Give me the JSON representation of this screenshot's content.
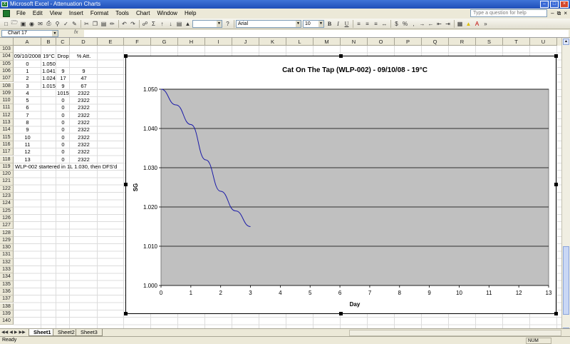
{
  "window": {
    "title": "Microsoft Excel - Attenuation Charts",
    "app_icon": "X"
  },
  "menu": {
    "items": [
      "File",
      "Edit",
      "View",
      "Insert",
      "Format",
      "Tools",
      "Chart",
      "Window",
      "Help"
    ],
    "help_placeholder": "Type a question for help"
  },
  "toolbar": {
    "font_name": "Arial",
    "font_size": "10",
    "bold_label": "B",
    "italic_label": "I",
    "underline_label": "U"
  },
  "formula": {
    "name_box": "Chart 17",
    "fx_label": "fx"
  },
  "columns": [
    "A",
    "B",
    "C",
    "D",
    "E",
    "F",
    "G",
    "H",
    "I",
    "J",
    "K",
    "L",
    "M",
    "N",
    "O",
    "P",
    "Q",
    "R",
    "S",
    "T",
    "U"
  ],
  "rows": [
    "103",
    "104",
    "105",
    "106",
    "107",
    "108",
    "109",
    "110",
    "111",
    "112",
    "113",
    "114",
    "115",
    "116",
    "117",
    "118",
    "119",
    "120",
    "121",
    "122",
    "123",
    "124",
    "125",
    "126",
    "127",
    "128",
    "129",
    "130",
    "131",
    "132",
    "133",
    "134",
    "135",
    "136",
    "137",
    "138",
    "139",
    "140"
  ],
  "cells": {
    "r104": [
      "09/10/2008",
      "19°C",
      "Drop",
      "% Att."
    ],
    "data": [
      [
        "0",
        "1.050",
        "",
        ""
      ],
      [
        "1",
        "1.041",
        "9",
        "9"
      ],
      [
        "2",
        "1.024",
        "17",
        "47"
      ],
      [
        "3",
        "1.015",
        "9",
        "67"
      ],
      [
        "4",
        "",
        "1015",
        "2322"
      ],
      [
        "5",
        "",
        "0",
        "2322"
      ],
      [
        "6",
        "",
        "0",
        "2322"
      ],
      [
        "7",
        "",
        "0",
        "2322"
      ],
      [
        "8",
        "",
        "0",
        "2322"
      ],
      [
        "9",
        "",
        "0",
        "2322"
      ],
      [
        "10",
        "",
        "0",
        "2322"
      ],
      [
        "11",
        "",
        "0",
        "2322"
      ],
      [
        "12",
        "",
        "0",
        "2322"
      ],
      [
        "13",
        "",
        "0",
        "2322"
      ]
    ],
    "note": "WLP-002 startered in 1L 1.030, then DFS'd"
  },
  "chart_data": {
    "type": "line",
    "title": "Cat On The Tap (WLP-002) - 09/10/08 - 19°C",
    "xlabel": "Day",
    "ylabel": "SG",
    "x": [
      0,
      0.5,
      1,
      1.5,
      2,
      2.5,
      3
    ],
    "series": [
      {
        "values": [
          1.05,
          1.046,
          1.041,
          1.032,
          1.024,
          1.019,
          1.015
        ]
      }
    ],
    "xlim": [
      0,
      13
    ],
    "ylim": [
      1.0,
      1.05
    ],
    "xticks": [
      "0",
      "1",
      "2",
      "3",
      "4",
      "5",
      "6",
      "7",
      "8",
      "9",
      "10",
      "11",
      "12",
      "13"
    ],
    "yticks": [
      "1.000",
      "1.010",
      "1.020",
      "1.030",
      "1.040",
      "1.050"
    ],
    "grid": true,
    "plot_bg": "#c0c0c0",
    "line_color": "#1a1aa8"
  },
  "sheets": {
    "tabs": [
      "Sheet1",
      "Sheet2",
      "Sheet3"
    ],
    "active": "Sheet1"
  },
  "status": {
    "left": "Ready",
    "num": "NUM"
  }
}
